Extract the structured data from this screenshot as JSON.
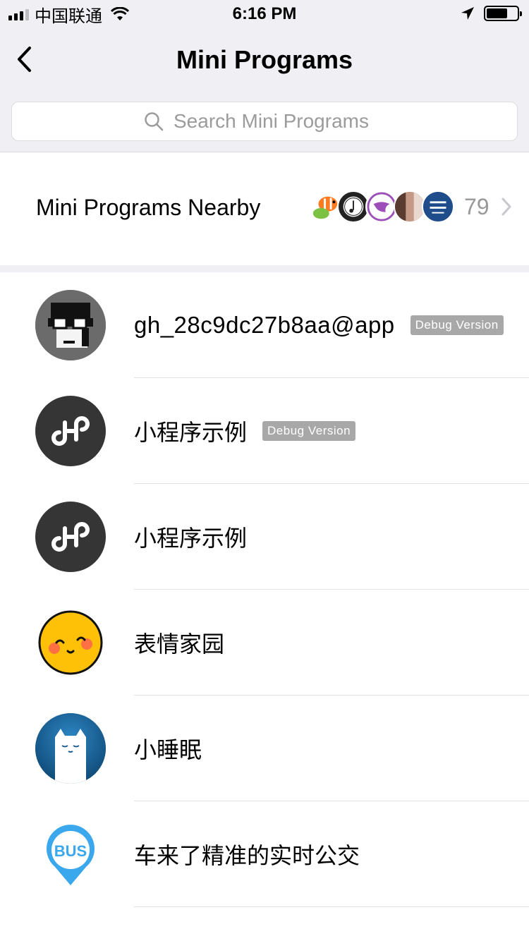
{
  "status_bar": {
    "carrier": "中国联通",
    "time": "6:16 PM"
  },
  "nav": {
    "title": "Mini Programs",
    "back_icon": "chevron-left-icon"
  },
  "search": {
    "placeholder": "Search Mini Programs",
    "value": ""
  },
  "nearby": {
    "label": "Mini Programs Nearby",
    "count": "79",
    "avatars": [
      "fish-logo",
      "vinyl-logo",
      "purple-badge-logo",
      "photo-logo",
      "blue-seal-logo"
    ]
  },
  "list": [
    {
      "title": "gh_28c9dc27b8aa@app",
      "badge": "Debug Version",
      "icon": "pixel-face-avatar"
    },
    {
      "title": "小程序示例",
      "badge": "Debug Version",
      "icon": "mini-program-link-icon"
    },
    {
      "title": "小程序示例",
      "badge": "",
      "icon": "mini-program-link-icon"
    },
    {
      "title": "表情家园",
      "badge": "",
      "icon": "smiley-face-icon"
    },
    {
      "title": "小睡眠",
      "badge": "",
      "icon": "sleeping-cat-icon"
    },
    {
      "title": "车来了精准的实时公交",
      "badge": "",
      "icon": "bus-pin-icon"
    }
  ],
  "colors": {
    "nav_background": "#efeff4",
    "badge": "#a8a8a8",
    "dark_icon": "#353535"
  }
}
